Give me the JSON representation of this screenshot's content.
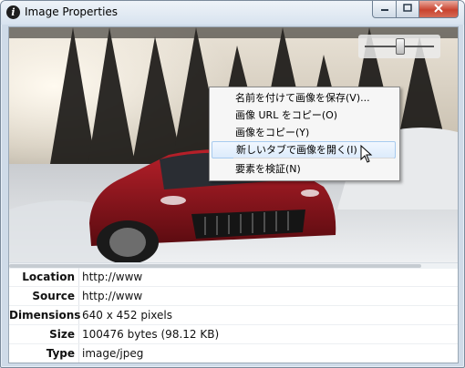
{
  "window": {
    "title": "Image Properties",
    "icon": "info-icon",
    "minimize_icon": "minimize-icon",
    "maximize_icon": "maximize-icon",
    "close_icon": "close-icon"
  },
  "image": {
    "description": "red sports car driving on snowy forest road",
    "zoom_level": 0.5
  },
  "context_menu": {
    "items": [
      {
        "label": "名前を付けて画像を保存(V)..."
      },
      {
        "label": "画像 URL をコピー(O)"
      },
      {
        "label": "画像をコピー(Y)"
      },
      {
        "label": "新しいタブで画像を開く(I)",
        "highlighted": true
      },
      {
        "label": "要素を検証(N)"
      }
    ]
  },
  "properties": [
    {
      "label": "Location",
      "value": "http://www"
    },
    {
      "label": "Source",
      "value": "http://www"
    },
    {
      "label": "Dimensions",
      "value": "640 x 452 pixels"
    },
    {
      "label": "Size",
      "value": "100476 bytes (98.12 KB)"
    },
    {
      "label": "Type",
      "value": "image/jpeg"
    }
  ]
}
